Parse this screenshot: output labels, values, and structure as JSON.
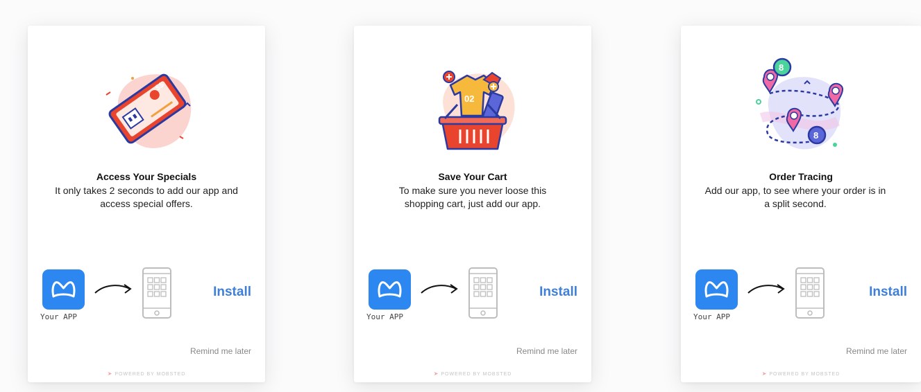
{
  "cards": [
    {
      "title": "Access Your Specials",
      "description": "It only takes 2 seconds to add our app and access special offers.",
      "illustration": "ticket-coupon-icon",
      "app_label": "Your APP",
      "install_label": "Install",
      "remind_label": "Remind me later",
      "powered_by": "POWERED BY MOBSTED"
    },
    {
      "title": "Save Your Cart",
      "description": "To make sure you never loose this shopping cart, just add our app.",
      "illustration": "shopping-basket-icon",
      "app_label": "Your APP",
      "install_label": "Install",
      "remind_label": "Remind me later",
      "powered_by": "POWERED BY MOBSTED"
    },
    {
      "title": "Order Tracing",
      "description": "Add our app, to see where your order is in a split second.",
      "illustration": "map-route-pins-icon",
      "app_label": "Your APP",
      "install_label": "Install",
      "remind_label": "Remind me later",
      "powered_by": "POWERED BY MOBSTED"
    }
  ],
  "colors": {
    "accent": "#3d7fd9",
    "app_icon_bg": "#2d87f0",
    "muted_text": "#888888"
  }
}
